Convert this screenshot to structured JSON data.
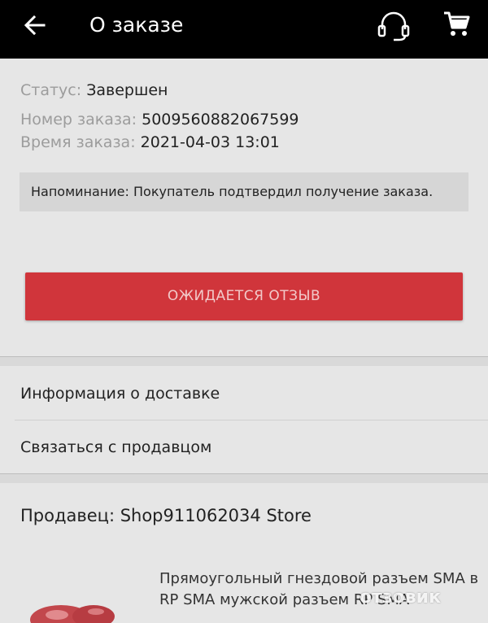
{
  "header": {
    "title": "О заказе",
    "back_icon": "arrow-left-icon",
    "support_icon": "headset-icon",
    "cart_icon": "cart-icon"
  },
  "order": {
    "status_label": "Статус:",
    "status_value": "Завершен",
    "number_label": "Номер заказа:",
    "number_value": "5009560882067599",
    "time_label": "Время заказа:",
    "time_value": "2021-04-03 13:01"
  },
  "reminder": "Напоминание: Покупатель подтвердил получение заказа.",
  "review_button": "ОЖИДАЕТСЯ ОТЗЫВ",
  "menu": {
    "delivery": "Информация о доставке",
    "contact": "Связаться с продавцом"
  },
  "seller": "Продавец: Shop911062034 Store",
  "product": {
    "title": "Прямоугольный гнездовой разъем SMA в RP SMA мужской разъем RP SMA"
  },
  "watermark": "отзовик",
  "colors": {
    "topbar": "#000000",
    "accent_button": "#d0353b",
    "background": "#e6e6e6"
  }
}
